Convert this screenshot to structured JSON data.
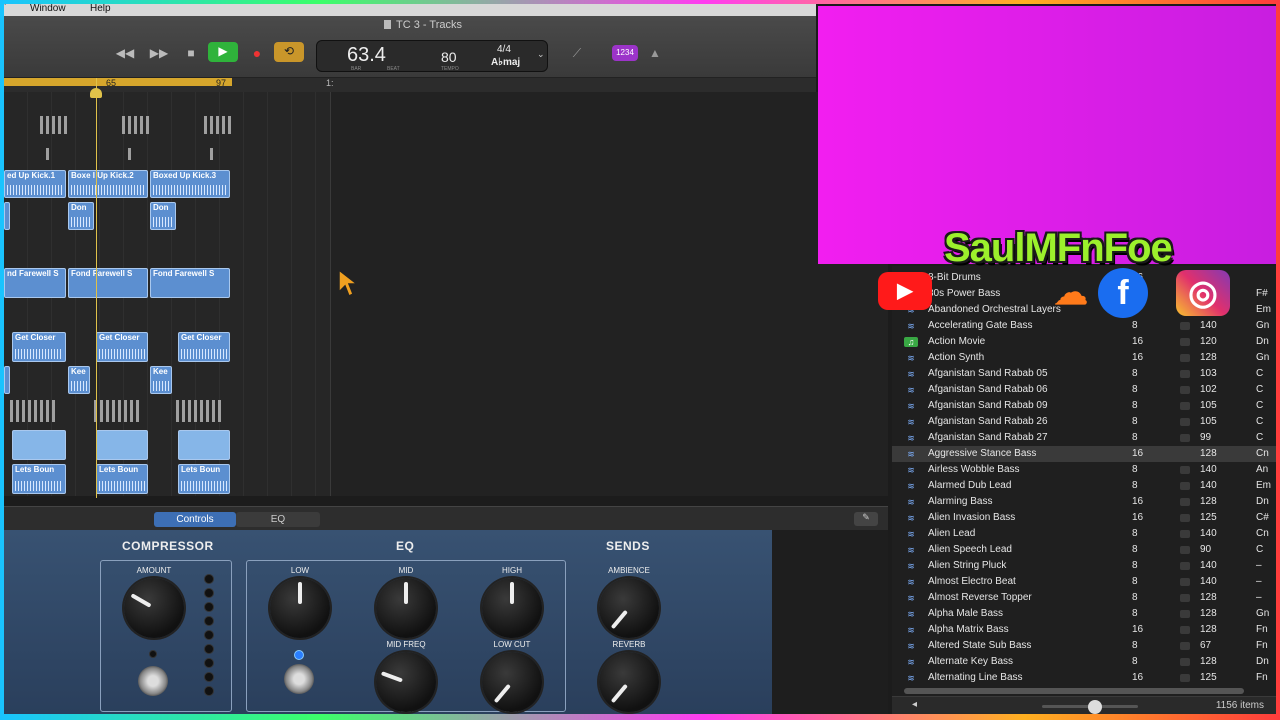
{
  "menubar": {
    "items": [
      "Window",
      "Help"
    ]
  },
  "window": {
    "title": "TC 3 - Tracks"
  },
  "transport": {
    "rewind": "◀◀",
    "forward": "▶▶",
    "stop": "■",
    "play": "▶",
    "record": "●",
    "cycle": "⟲",
    "bar_beat": "63.4",
    "bar_label": "BAR",
    "beat_label": "BEAT",
    "tempo": "80",
    "tempo_label": "TEMPO",
    "signature": "4/4",
    "key": "A♭maj",
    "count_in": "1234"
  },
  "ruler": {
    "markers": [
      "65",
      "97",
      "1:"
    ]
  },
  "regions": [
    "ed Up Kick.1",
    "Boxe I Up Kick.2",
    "Boxed Up Kick.3",
    "Don",
    "Don",
    "nd Farewell S",
    "Fond Farewell S",
    "Fond Farewell S",
    "Get Closer",
    "Get Closer",
    "Get Closer",
    "Kee",
    "Kee",
    "Lets Boun",
    "Lets Boun",
    "Lets Boun"
  ],
  "smart_controls": {
    "tabs": [
      "Controls",
      "EQ"
    ],
    "sections": {
      "compressor": "COMPRESSOR",
      "eq": "EQ",
      "sends": "SENDS"
    },
    "knobs": {
      "amount": "AMOUNT",
      "low": "LOW",
      "mid": "MID",
      "high": "HIGH",
      "mid_freq": "MID FREQ",
      "low_cut": "LOW CUT",
      "ambience": "AMBIENCE",
      "reverb": "REVERB"
    }
  },
  "library": {
    "partial_rows": [
      "8-Bit Drums",
      "80s Power Bass",
      "Abandoned Orchestral Layers"
    ],
    "partial_values": [
      "16",
      "F#",
      "Em"
    ],
    "rows": [
      {
        "name": "Accelerating Gate Bass",
        "beats": "8",
        "tempo": "140",
        "key": "Gn"
      },
      {
        "name": "Action Movie",
        "beats": "16",
        "tempo": "120",
        "key": "Dn"
      },
      {
        "name": "Action Synth",
        "beats": "16",
        "tempo": "128",
        "key": "Gn"
      },
      {
        "name": "Afganistan Sand Rabab 05",
        "beats": "8",
        "tempo": "103",
        "key": "C"
      },
      {
        "name": "Afganistan Sand Rabab 06",
        "beats": "8",
        "tempo": "102",
        "key": "C"
      },
      {
        "name": "Afganistan Sand Rabab 09",
        "beats": "8",
        "tempo": "105",
        "key": "C"
      },
      {
        "name": "Afganistan Sand Rabab 26",
        "beats": "8",
        "tempo": "105",
        "key": "C"
      },
      {
        "name": "Afganistan Sand Rabab 27",
        "beats": "8",
        "tempo": "99",
        "key": "C"
      },
      {
        "name": "Aggressive Stance Bass",
        "beats": "16",
        "tempo": "128",
        "key": "Cn"
      },
      {
        "name": "Airless Wobble Bass",
        "beats": "8",
        "tempo": "140",
        "key": "An"
      },
      {
        "name": "Alarmed Dub Lead",
        "beats": "8",
        "tempo": "140",
        "key": "Em"
      },
      {
        "name": "Alarming Bass",
        "beats": "16",
        "tempo": "128",
        "key": "Dn"
      },
      {
        "name": "Alien Invasion Bass",
        "beats": "16",
        "tempo": "125",
        "key": "C#"
      },
      {
        "name": "Alien Lead",
        "beats": "8",
        "tempo": "140",
        "key": "Cn"
      },
      {
        "name": "Alien Speech Lead",
        "beats": "8",
        "tempo": "90",
        "key": "C"
      },
      {
        "name": "Alien String Pluck",
        "beats": "8",
        "tempo": "140",
        "key": "–"
      },
      {
        "name": "Almost Electro Beat",
        "beats": "8",
        "tempo": "140",
        "key": "–"
      },
      {
        "name": "Almost Reverse Topper",
        "beats": "8",
        "tempo": "128",
        "key": "–"
      },
      {
        "name": "Alpha Male Bass",
        "beats": "8",
        "tempo": "128",
        "key": "Gn"
      },
      {
        "name": "Alpha Matrix Bass",
        "beats": "16",
        "tempo": "128",
        "key": "Fn"
      },
      {
        "name": "Altered State Sub Bass",
        "beats": "8",
        "tempo": "67",
        "key": "Fn"
      },
      {
        "name": "Alternate Key Bass",
        "beats": "8",
        "tempo": "128",
        "key": "Dn"
      },
      {
        "name": "Alternating Line Bass",
        "beats": "16",
        "tempo": "125",
        "key": "Fn"
      }
    ],
    "footer_count": "1156 items"
  },
  "overlay": {
    "brand": "SaulMFnFoe"
  },
  "colors": {
    "accent_blue": "#3d6fb5",
    "play_green": "#2fb33b",
    "cycle_gold": "#d6a62c",
    "overlay_magenta": "#f21ef0",
    "brand_green": "#9cf02c"
  }
}
